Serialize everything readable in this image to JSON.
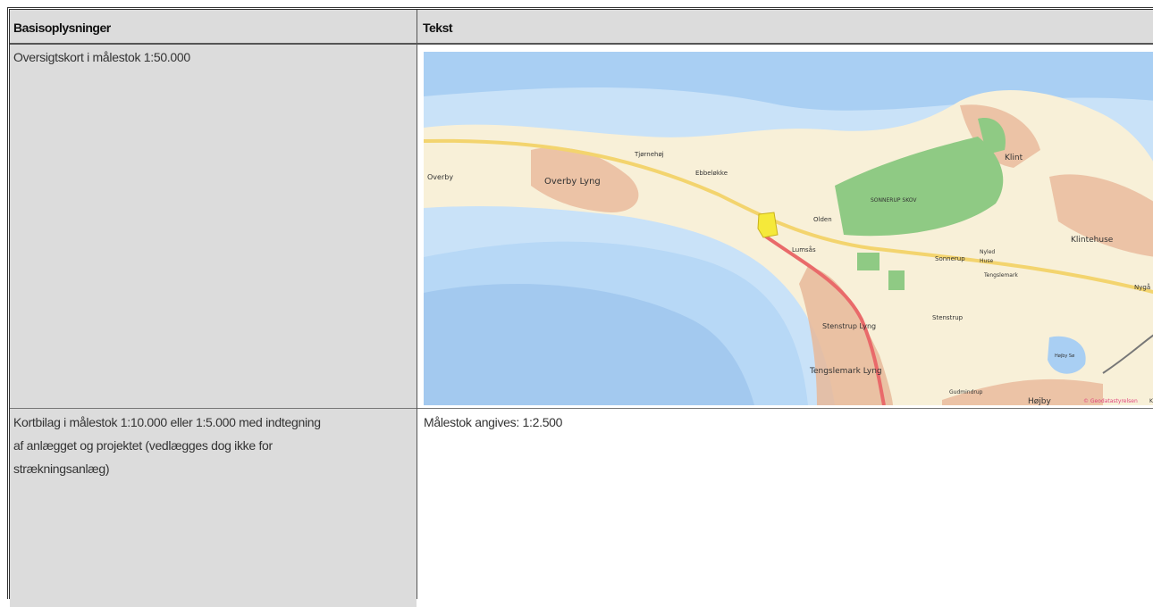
{
  "table": {
    "headers": [
      "Basisoplysninger",
      "Tekst"
    ],
    "rows": [
      {
        "label": "Oversigtskort i målestok 1:50.000",
        "value_type": "map"
      },
      {
        "label_lines": [
          "Kortbilag i målestok 1:10.000 eller 1:5.000 med indtegning",
          "af anlægget og projektet (vedlægges dog ikke for",
          "strækningsanlæg)"
        ],
        "value": "Målestok angives: 1:2.500"
      }
    ]
  },
  "map": {
    "place_labels": {
      "overby": "Overby",
      "overby_lyng": "Overby Lyng",
      "tjornehoj": "Tjørnehøj",
      "ebbeloekke": "Ebbeløkke",
      "klint": "Klint",
      "sonnerup_skov": "SONNERUP SKOV",
      "olden": "Olden",
      "lumsas": "Lumsås",
      "sonnerup": "Sonnerup",
      "nyled_huse_1": "Nyled",
      "nyled_huse_2": "Huse",
      "klintehuse": "Klintehuse",
      "tengslemark": "Tengslemark",
      "nyga": "Nygå",
      "stenstrup_lyng": "Stenstrup Lyng",
      "stenstrup": "Stenstrup",
      "tengslemark_lyng": "Tengslemark Lyng",
      "gudmindrup": "Gudmindrup",
      "hojby": "Højby",
      "hojby_so": "Højby Sø"
    },
    "attribution": "© Geodatastyrelsen",
    "attribution_tail": "K",
    "colors": {
      "sea_deep": "#a9cff3",
      "sea_shallow": "#c9e2f8",
      "land": "#f8f0d8",
      "urban": "#e8b89a",
      "forest": "#8fca84",
      "road_main": "#f3d46e",
      "road_rail": "#e96a6a",
      "project_area": "#f5e93a"
    }
  }
}
